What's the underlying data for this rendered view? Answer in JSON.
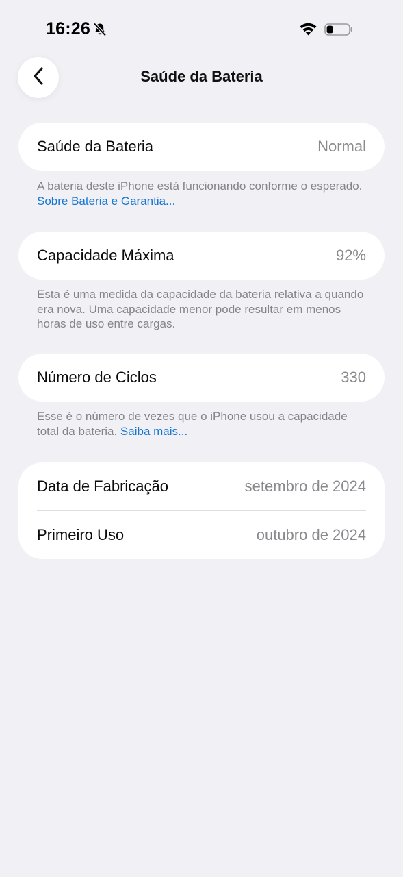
{
  "status_bar": {
    "time": "16:26",
    "icons": [
      "bell-slash-icon",
      "wifi-icon",
      "battery-icon"
    ]
  },
  "nav": {
    "back_icon": "chevron-left-icon",
    "title": "Saúde da Bateria"
  },
  "sections": {
    "health": {
      "label": "Saúde da Bateria",
      "value": "Normal",
      "footnote_text": "A bateria deste iPhone está funcionando conforme o esperado. ",
      "footnote_link": "Sobre Bateria e Garantia..."
    },
    "capacity": {
      "label": "Capacidade Máxima",
      "value": "92%",
      "footnote_text": "Esta é uma medida da capacidade da bateria relativa a quando era nova. Uma capacidade menor pode resultar em menos horas de uso entre cargas."
    },
    "cycles": {
      "label": "Número de Ciclos",
      "value": "330",
      "footnote_text": "Esse é o número de vezes que o iPhone usou a capacidade total da bateria. ",
      "footnote_link": "Saiba mais..."
    },
    "dates": {
      "manufacture_label": "Data de Fabricação",
      "manufacture_value": "setembro de 2024",
      "first_use_label": "Primeiro Uso",
      "first_use_value": "outubro de 2024"
    }
  },
  "colors": {
    "background": "#f1f0f5",
    "card": "#ffffff",
    "secondary_text": "#8a8a8e",
    "link": "#1677d2"
  }
}
